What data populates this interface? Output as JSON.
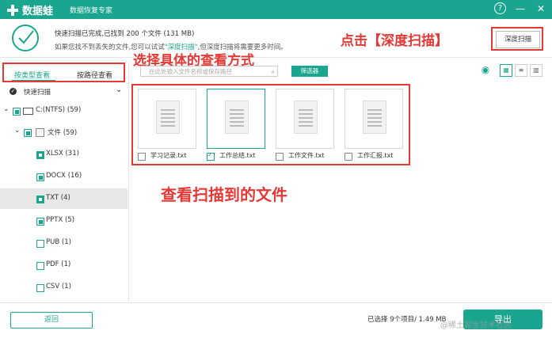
{
  "app": {
    "name": "数据蛙",
    "subtitle": "数据恢复专家"
  },
  "window": {
    "help": "?",
    "minimize": "—",
    "close": "✕"
  },
  "status": {
    "line1": "快速扫描已完成,已找到 200 个文件 (131 MB)",
    "line2_pre": "如果您找不到丢失的文件,您可以试试",
    "line2_link": "\"深度扫描\"",
    "line2_post": ",但深度扫描将需要更多时间。"
  },
  "deep_scan_button": "深度扫描",
  "annotations": {
    "deep": "点击【深度扫描】",
    "view": "选择具体的查看方式",
    "files": "查看扫描到的文件"
  },
  "tabs": {
    "by_type": "按类型查看",
    "by_path": "按路径查看"
  },
  "tree": {
    "quick": "快速扫描",
    "drive": "C:(NTFS) (59)",
    "folder": "文件 (59)",
    "types": [
      "XLSX (31)",
      "DOCX (16)",
      "TXT (4)",
      "PPTX (5)",
      "PUB (1)",
      "PDF (1)",
      "CSV (1)"
    ]
  },
  "search": {
    "placeholder": "在此处输入文件名称或保存路径"
  },
  "filter_button": "筛选器",
  "files": [
    {
      "name": "学习记录.txt",
      "checked": false
    },
    {
      "name": "工作总结.txt",
      "checked": true
    },
    {
      "name": "工作文件.txt",
      "checked": false
    },
    {
      "name": "工作汇报.txt",
      "checked": false
    }
  ],
  "footer": {
    "back": "返回",
    "selection": "已选择 9个项目/ 1.49 MB",
    "export": "导出"
  },
  "watermark": "@稀土掘金技术社区",
  "colors": {
    "accent": "#1aa58e",
    "annotation": "#e53935"
  }
}
